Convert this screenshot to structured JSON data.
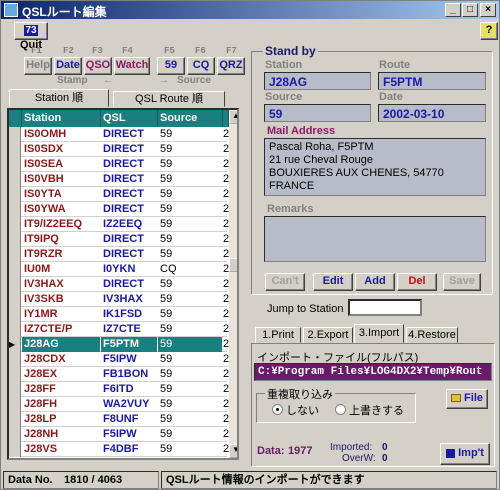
{
  "window": {
    "title": "QSLルート編集",
    "min": "_",
    "max": "□",
    "close": "×"
  },
  "toolbar": {
    "quit_key": "73",
    "quit_label": "Quit",
    "help_icon": "?"
  },
  "fkeys": [
    "F1",
    "F2",
    "F3",
    "F4",
    "F5",
    "F6",
    "F7"
  ],
  "fbuttons": [
    "Help",
    "Date",
    "QSO",
    "Watch",
    "59",
    "CQ",
    "QRZ"
  ],
  "groups": {
    "stamp": "Stamp",
    "source": "Source",
    "arrow_left": "←",
    "arrow_right": "→"
  },
  "tabs": {
    "station_order": "Station 順",
    "route_order": "QSL Route 順"
  },
  "grid": {
    "headers": [
      "Station",
      "QSL Route",
      "Source"
    ],
    "rows": [
      [
        "IS0OMH",
        "DIRECT",
        "59",
        "2"
      ],
      [
        "IS0SDX",
        "DIRECT",
        "59",
        "2"
      ],
      [
        "IS0SEA",
        "DIRECT",
        "59",
        "2"
      ],
      [
        "IS0VBH",
        "DIRECT",
        "59",
        "2"
      ],
      [
        "IS0YTA",
        "DIRECT",
        "59",
        "2"
      ],
      [
        "IS0YWA",
        "DIRECT",
        "59",
        "2"
      ],
      [
        "IT9/IZ2EEQ",
        "IZ2EEQ",
        "59",
        "2"
      ],
      [
        "IT9IPQ",
        "DIRECT",
        "59",
        "2"
      ],
      [
        "IT9RZR",
        "DIRECT",
        "59",
        "2"
      ],
      [
        "IU0M",
        "I0YKN",
        "CQ",
        "2"
      ],
      [
        "IV3HAX",
        "DIRECT",
        "59",
        "2"
      ],
      [
        "IV3SKB",
        "IV3HAX",
        "59",
        "2"
      ],
      [
        "IY1MR",
        "IK1FSD",
        "59",
        "2"
      ],
      [
        "IZ7CTE/P",
        "IZ7CTE",
        "59",
        "2"
      ],
      [
        "J28AG",
        "F5PTM",
        "59",
        "2"
      ],
      [
        "J28CDX",
        "F5IPW",
        "59",
        "2"
      ],
      [
        "J28EX",
        "FB1BON",
        "59",
        "2"
      ],
      [
        "J28FF",
        "F6ITD",
        "59",
        "2"
      ],
      [
        "J28FH",
        "WA2VUY",
        "59",
        "2"
      ],
      [
        "J28LP",
        "F8UNF",
        "59",
        "2"
      ],
      [
        "J28NH",
        "F5IPW",
        "59",
        "2"
      ],
      [
        "J28VS",
        "F4DBF",
        "59",
        "2"
      ]
    ],
    "selected_index": 14
  },
  "standby": {
    "title": "Stand by",
    "station_label": "Station",
    "station": "J28AG",
    "route_label": "Route",
    "route": "F5PTM",
    "source_label": "Source",
    "source": "59",
    "date_label": "Date",
    "date": "2002-03-10",
    "mail_label": "Mail Address",
    "mail": "Pascal Roha, F5PTM\n21 rue Cheval Rouge\nBOUXIERES AUX CHENES, 54770\nFRANCE",
    "remarks_label": "Remarks",
    "remarks": ""
  },
  "actions": {
    "cancel": "Can't",
    "edit": "Edit",
    "add": "Add",
    "del": "Del",
    "save": "Save"
  },
  "jump": {
    "label": "Jump to Station",
    "value": ""
  },
  "subtabs": [
    "1.Print",
    "2.Export",
    "3.Import",
    "4.Restore"
  ],
  "import": {
    "file_label": "インポート・ファイル(フルパス)",
    "file_path": "C:¥Program Files¥LOG4DX2¥Temp¥Rout",
    "dup_label": "重複取り込み",
    "opt_no": "しない",
    "opt_overwrite": "上書きする",
    "file_button": "File",
    "data_label": "Data:",
    "data_value": "1977",
    "imported_label": "Imported:",
    "imported_value": "0",
    "overw_label": "OverW:",
    "overw_value": "0",
    "import_button": "Imp't"
  },
  "statusbar": {
    "label": "Data No.",
    "value": "1810 / 4063",
    "message": "QSLルート情報のインポートができます"
  },
  "colors": {
    "grid_header": "#1a7f7f",
    "station_text": "#8a1a1a",
    "route_text": "#1a1aa0",
    "path_bg": "#6a1a6a"
  }
}
